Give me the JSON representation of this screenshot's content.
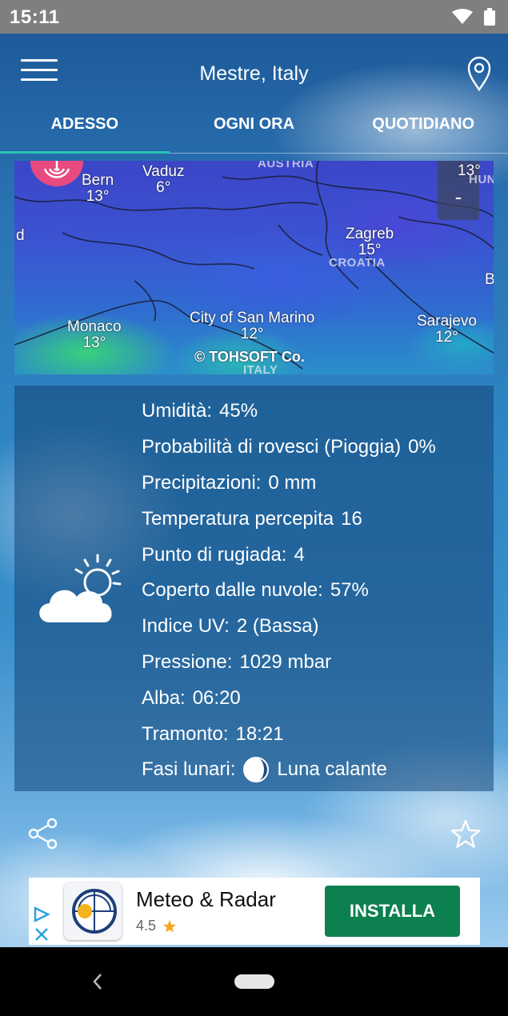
{
  "status_bar": {
    "time": "15:11"
  },
  "header": {
    "title": "Mestre, Italy"
  },
  "tabs": [
    {
      "label": "ADESSO",
      "active": true
    },
    {
      "label": "OGNI ORA",
      "active": false
    },
    {
      "label": "QUOTIDIANO",
      "active": false
    }
  ],
  "map": {
    "cities": [
      {
        "name": "Bern",
        "temp": "13°"
      },
      {
        "name": "Vaduz",
        "temp": "6°"
      },
      {
        "name": "Zagreb",
        "temp": "15°"
      },
      {
        "name": "Monaco",
        "temp": "13°"
      },
      {
        "name": "City of San Marino",
        "temp": "12°"
      },
      {
        "name": "Sarajevo",
        "temp": "12°"
      }
    ],
    "partial_temp": "13°",
    "countries": {
      "austria": "AUSTRIA",
      "croatia": "CROATIA",
      "italy": "ITALY",
      "hun": "HUN"
    },
    "edge_letters": {
      "left": "d",
      "right": "B"
    },
    "copyright": "© TOHSOFT Co.",
    "zoom_out_label": "-"
  },
  "details": [
    {
      "label": "Umidità:",
      "value": "45%"
    },
    {
      "label": "Probabilità di rovesci (Pioggia)",
      "value": "0%"
    },
    {
      "label": "Precipitazioni:",
      "value": "0 mm"
    },
    {
      "label": "Temperatura percepita",
      "value": "16"
    },
    {
      "label": "Punto di rugiada:",
      "value": "4"
    },
    {
      "label": "Coperto dalle nuvole:",
      "value": "57%"
    },
    {
      "label": "Indice UV:",
      "value": "2 (Bassa)"
    },
    {
      "label": "Pressione:",
      "value": "1029 mbar"
    },
    {
      "label": "Alba:",
      "value": "06:20"
    },
    {
      "label": "Tramonto:",
      "value": "18:21"
    },
    {
      "label": "Fasi lunari:",
      "value": "Luna calante"
    }
  ],
  "ad": {
    "app_name": "Meteo & Radar",
    "rating": "4.5",
    "install_label": "INSTALLA"
  },
  "colors": {
    "accent_tab_indicator": "#27c3b5",
    "install_button": "#0d8050",
    "radar_button": "#e84a7f"
  },
  "icons": [
    "menu-icon",
    "location-pin-icon",
    "radar-icon",
    "partly-cloudy-icon",
    "moon-phase-icon",
    "share-icon",
    "star-icon",
    "adchoices-icon",
    "wifi-icon",
    "battery-icon",
    "nav-back-icon"
  ]
}
